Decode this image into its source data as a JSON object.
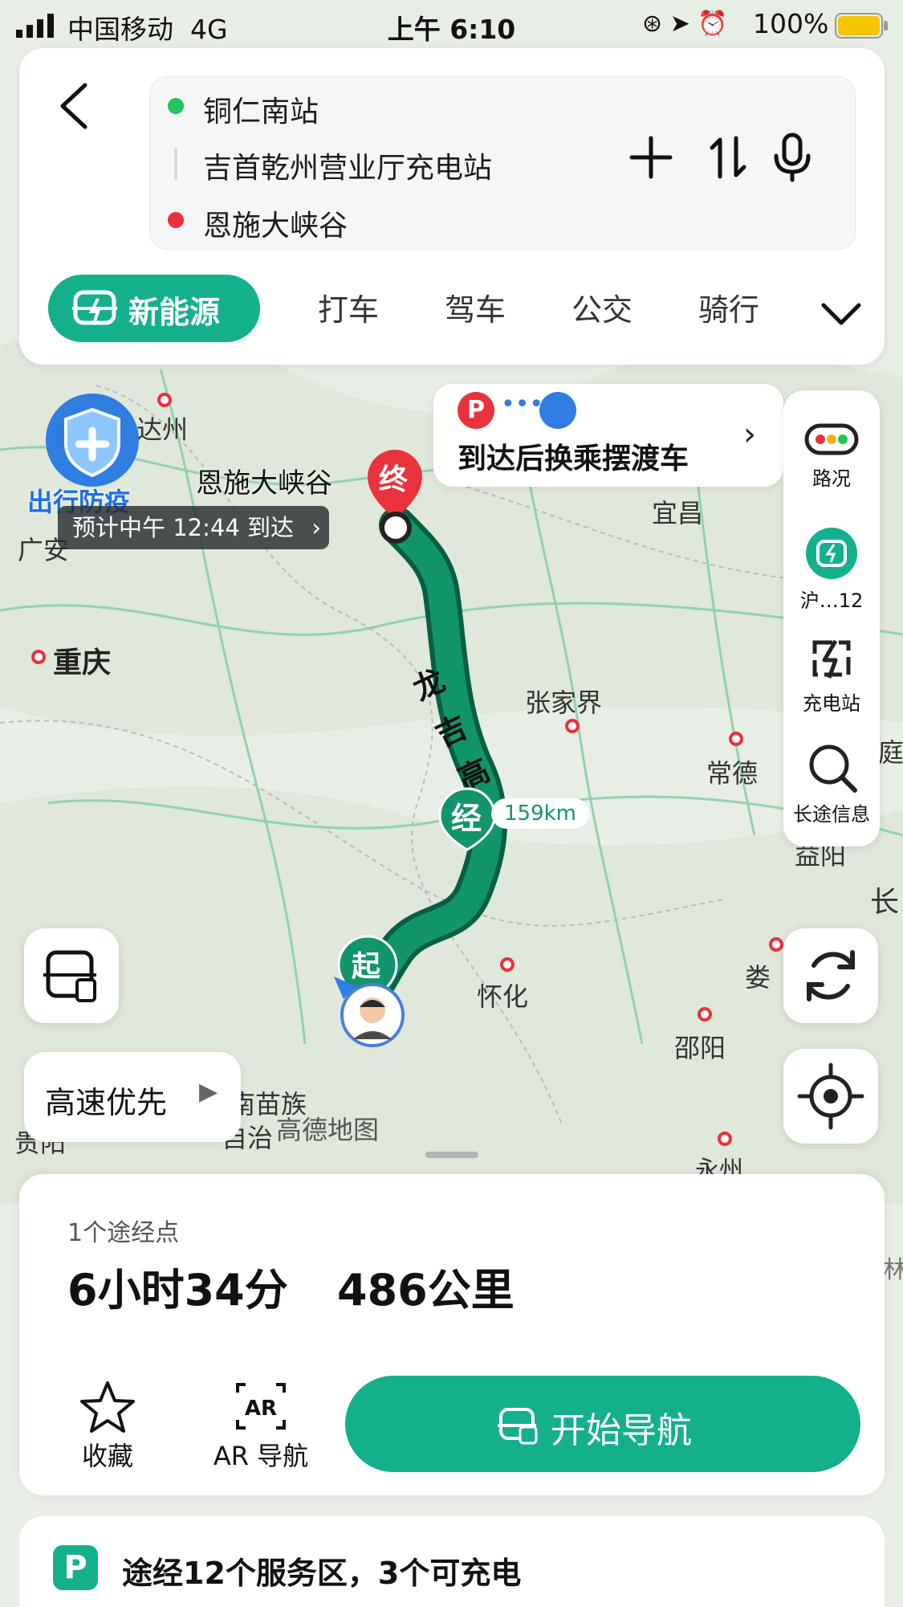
{
  "status_bar": {
    "carrier": "中国移动",
    "network": "4G",
    "time": "上午 6:10",
    "battery": "100%"
  },
  "back_icon": "chevron-left-icon",
  "route": {
    "origin": "铜仁南站",
    "waypoint": "吉首乾州营业厅充电站",
    "destination": "恩施大峡谷"
  },
  "tabs": {
    "active": "新能源",
    "items": [
      "打车",
      "驾车",
      "公交",
      "骑行"
    ]
  },
  "map": {
    "labels": {
      "dazhou": "达州",
      "guangan": "广安",
      "chongqing": "重庆",
      "enshi": "恩施大峡谷",
      "yichang": "宜昌",
      "zhangjiajie": "张家界",
      "changde": "常德",
      "huaihua": "怀化",
      "shaoyang": "邵阳",
      "yongzhou": "永州",
      "lou": "娄",
      "guiyang": "贵阳",
      "miaozu": "南苗族",
      "zizhi": "自治",
      "gaode": "高德地图",
      "yiyang": "益阳",
      "chang": "长",
      "ting": "庭",
      "lin": "林"
    },
    "highway_name": [
      "龙",
      "吉",
      "高"
    ],
    "arrival_tag": "预计中午 12:44 到达",
    "epidemic_badge": "出行防疫",
    "shuttle_tip": "到达后换乘摆渡车",
    "waypoint_marker": "经",
    "waypoint_distance": "159km",
    "start_marker": "起",
    "end_marker": "终",
    "route_preference": "高速优先"
  },
  "side_panel": {
    "traffic": "路况",
    "plate": "沪…12",
    "charging": "充电站",
    "long_trip": "长途信息"
  },
  "summary": {
    "waypoints": "1个途经点",
    "duration": "6小时34分",
    "distance": "486公里"
  },
  "actions": {
    "favorite": "收藏",
    "ar_nav": "AR 导航",
    "start_nav": "开始导航"
  },
  "service_info": "途经12个服务区，3个可充电",
  "colors": {
    "brand_green": "#14b08e",
    "route_green": "#0b8a5e",
    "end_red": "#e8323c"
  }
}
